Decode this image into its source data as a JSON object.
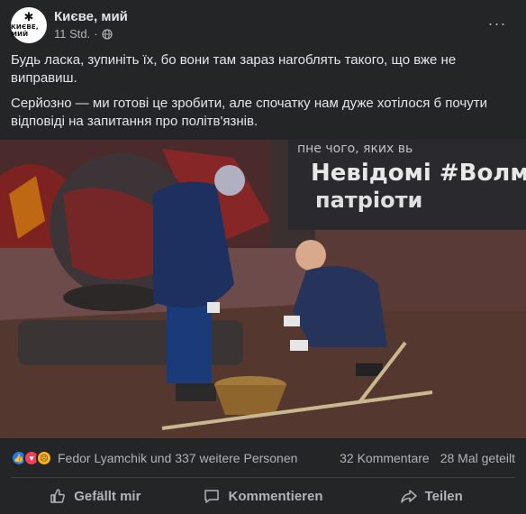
{
  "post": {
    "page_name": "Києве, мий",
    "avatar_text": "КИЄВЕ, МИЙ",
    "avatar_symbol": "✱",
    "time": "11 Std.",
    "dot": "·",
    "more": "···",
    "paragraphs": [
      "Будь ласка, зупиніть їх, бо вони там зараз наroблять такого, що вже не виправиш.",
      "Серйозно — ми готові це зробити, але спочатку нам дуже хотілося б почути відповіді на запитання про політв'язнів."
    ]
  },
  "photo": {
    "wall_text_top": "пне чого, яких  вь",
    "wall_text_main": "Невідомі #Волм",
    "wall_text_second": "патріоти"
  },
  "stats": {
    "reactions": [
      "like",
      "love",
      "sad"
    ],
    "reaction_names": "Fedor Lyamchik und 337 weitere Personen",
    "comments": "32 Kommentare",
    "shares": "28 Mal geteilt"
  },
  "actions": {
    "like": "Gefällt mir",
    "comment": "Kommentieren",
    "share": "Teilen"
  },
  "colors": {
    "card_bg": "#242526",
    "text": "#e4e6eb",
    "secondary": "#b0b3b8",
    "like_blue": "#2078f4",
    "love_red": "#f33e58",
    "sad_yellow": "#f7b125"
  }
}
